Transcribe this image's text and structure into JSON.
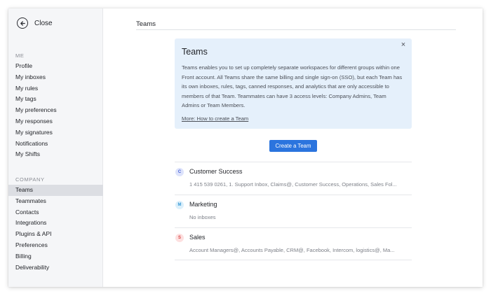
{
  "sidebar": {
    "close_label": "Close",
    "me_title": "ME",
    "me_items": [
      {
        "label": "Profile"
      },
      {
        "label": "My inboxes"
      },
      {
        "label": "My rules"
      },
      {
        "label": "My tags"
      },
      {
        "label": "My preferences"
      },
      {
        "label": "My responses"
      },
      {
        "label": "My signatures"
      },
      {
        "label": "Notifications"
      },
      {
        "label": "My Shifts"
      }
    ],
    "company_title": "COMPANY",
    "company_items": [
      {
        "label": "Teams",
        "active": true
      },
      {
        "label": "Teammates"
      },
      {
        "label": "Contacts"
      },
      {
        "label": "Integrations"
      },
      {
        "label": "Plugins & API"
      },
      {
        "label": "Preferences"
      },
      {
        "label": "Billing"
      },
      {
        "label": "Deliverability"
      }
    ]
  },
  "main": {
    "title": "Teams",
    "info": {
      "title": "Teams",
      "text": "Teams enables you to set up completely separate workspaces for different groups within one Front account. All Teams share the same billing and single sign-on (SSO), but each Team has its own inboxes, rules, tags, canned responses, and analytics that are only accessible to members of that Team. Teammates can have 3 access levels: Company Admins, Team Admins or Team Members.",
      "link": "More: How to create a Team",
      "close_glyph": "×"
    },
    "create_button": "Create a Team",
    "teams": [
      {
        "initial": "C",
        "name": "Customer Success",
        "desc": "1 415 539 0261, 1. Support Inbox, Claims@, Customer Success, Operations, Sales Fol...",
        "badge_bg": "#dde3fb",
        "badge_fg": "#4a63d8"
      },
      {
        "initial": "M",
        "name": "Marketing",
        "desc": "No inboxes",
        "badge_bg": "#dcf0fb",
        "badge_fg": "#3a9ad6"
      },
      {
        "initial": "S",
        "name": "Sales",
        "desc": "Account Managers@, Accounts Payable, CRM@, Facebook, Intercom, logistics@, Ma...",
        "badge_bg": "#fde0e0",
        "badge_fg": "#d84848"
      }
    ]
  },
  "colors": {
    "accent": "#2b74de",
    "sidebar_bg": "#f5f6f8",
    "active_item_bg": "#dcdee3",
    "info_bg": "#e5f0fb"
  },
  "icons": {
    "close": "back-arrow-circle-icon"
  }
}
